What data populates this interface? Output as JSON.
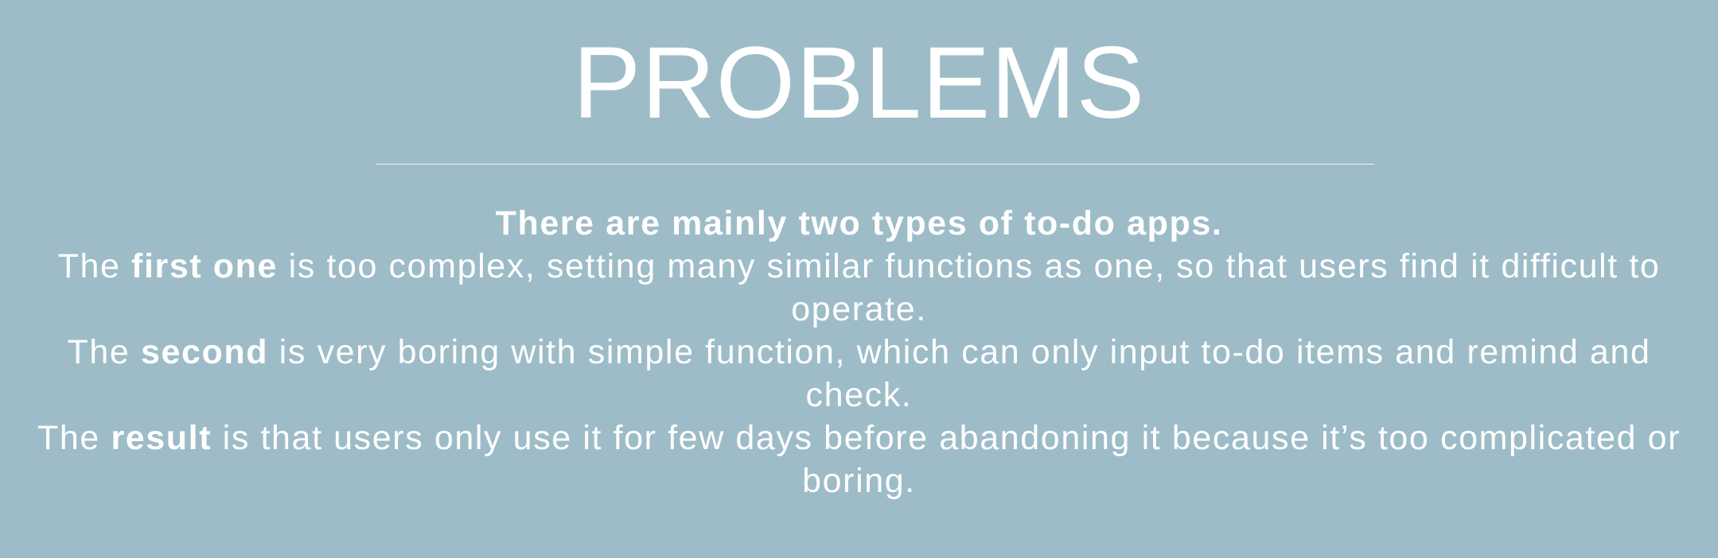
{
  "slide": {
    "title": "PROBLEMS",
    "background_color": "#9dbcc7",
    "text_color": "#ffffff",
    "paragraphs": {
      "intro": "There are mainly two types of to-do apps.",
      "first": {
        "prefix": "The ",
        "emphasis": "first one",
        "rest": " is too complex, setting many similar functions as one, so that users find it difficult to operate."
      },
      "second": {
        "prefix": "The ",
        "emphasis": "second",
        "rest": " is very boring with simple function, which can only input to-do items and remind and check."
      },
      "result": {
        "prefix": "The ",
        "emphasis": "result",
        "rest": " is that users only use it for few days before abandoning it because it’s too complicated or boring."
      }
    }
  }
}
